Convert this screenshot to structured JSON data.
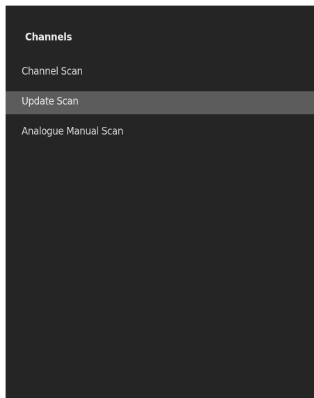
{
  "panel": {
    "title": "Channels"
  },
  "menu": {
    "items": [
      {
        "label": "Channel Scan",
        "selected": false
      },
      {
        "label": "Update Scan",
        "selected": true
      },
      {
        "label": "Analogue Manual Scan",
        "selected": false
      }
    ]
  }
}
